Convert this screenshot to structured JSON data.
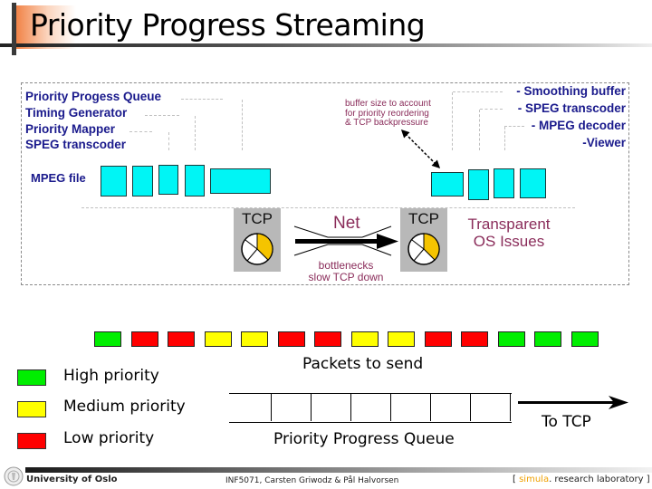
{
  "slide": {
    "title": "Priority Progress Streaming"
  },
  "architecture": {
    "sender_components": [
      "Priority Progess Queue",
      "Timing Generator",
      "Priority Mapper",
      "SPEG transcoder"
    ],
    "mpeg_file_label": "MPEG file",
    "receiver_components": [
      "- Smoothing buffer",
      "- SPEG transcoder",
      "- MPEG decoder",
      "-Viewer"
    ],
    "buffer_note": [
      "buffer size to account",
      "for priority reordering",
      "& TCP backpressure"
    ],
    "tcp_left_label": "TCP",
    "tcp_right_label": "TCP",
    "net_label": "Net",
    "bottleneck_note": [
      "bottlenecks",
      "slow TCP down"
    ],
    "os_note": [
      "Transparent",
      "OS Issues"
    ],
    "colors": {
      "component_text": "#1a1a8c",
      "note_text": "#8a2c5a",
      "frame_box": "#00f5f5",
      "pie_fill": "#f5c400"
    }
  },
  "packets": {
    "caption": "Packets to send",
    "sequence": [
      "high",
      "low",
      "low",
      "medium",
      "medium",
      "low",
      "low",
      "medium",
      "medium",
      "low",
      "low",
      "high",
      "high",
      "high"
    ]
  },
  "legend": {
    "items": [
      {
        "key": "high",
        "label": "High priority",
        "color": "#00ee00"
      },
      {
        "key": "medium",
        "label": "Medium priority",
        "color": "#ffff00"
      },
      {
        "key": "low",
        "label": "Low priority",
        "color": "#ff0000"
      }
    ]
  },
  "queue": {
    "caption": "Priority Progress Queue",
    "slot_count": 7,
    "output_label": "To TCP"
  },
  "footer": {
    "institution": "University of Oslo",
    "course": "INF5071, Carsten Griwodz & Pål Halvorsen",
    "lab_bracket_open": "[",
    "lab_name": "simula",
    "lab_rest": ". research laboratory ]",
    "lab_accent": "#f0a000"
  }
}
